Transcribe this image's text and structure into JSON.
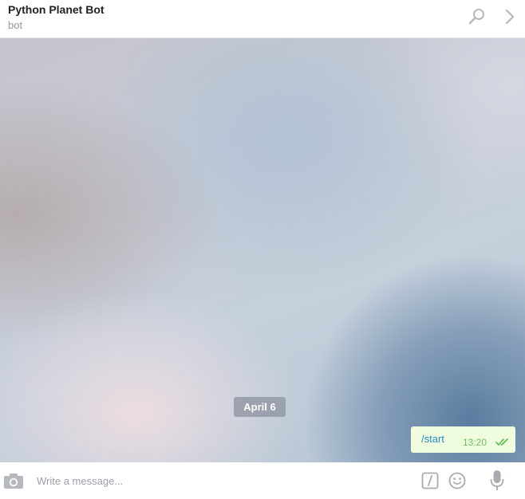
{
  "header": {
    "title": "Python Planet Bot",
    "subtitle": "bot",
    "search_icon": "search-icon",
    "more_icon": "chevron-right-icon"
  },
  "chat": {
    "date_separator": "April 6",
    "messages": [
      {
        "text": "/start",
        "time": "13:20",
        "status": "read",
        "status_icon": "double-check-icon"
      }
    ],
    "colors": {
      "outgoing_bubble": "#effdde",
      "command_link": "#2b8ac8",
      "time_text": "#6cc264"
    }
  },
  "composer": {
    "placeholder": "Write a message...",
    "value": "",
    "icons": [
      "camera-icon",
      "bot-command-icon",
      "emoji-icon",
      "microphone-icon"
    ]
  }
}
